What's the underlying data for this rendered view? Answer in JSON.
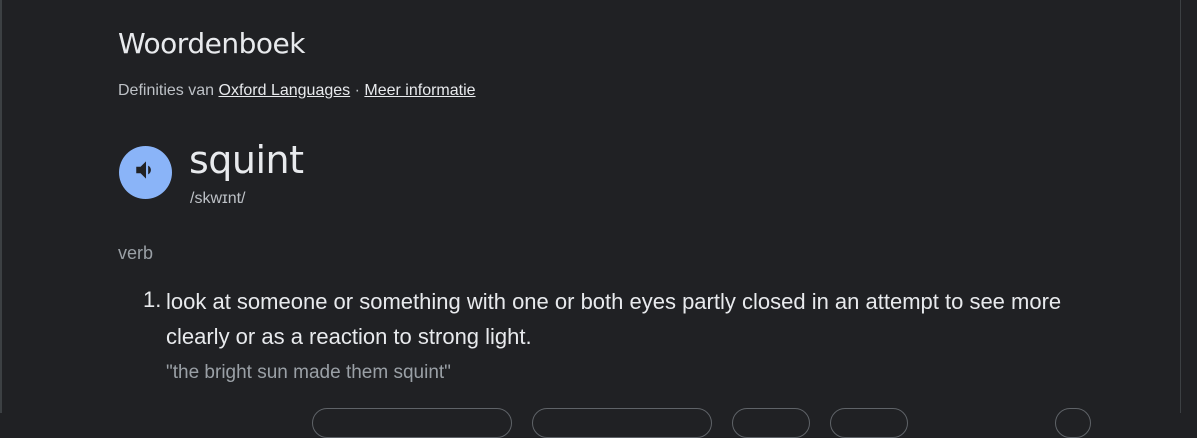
{
  "header": {
    "title": "Woordenboek",
    "source_prefix": "Definities van",
    "source_link": "Oxford Languages",
    "separator": "·",
    "more_info_link": "Meer informatie"
  },
  "entry": {
    "word": "squint",
    "phonetic": "/skwɪnt/",
    "speaker_icon": "volume-icon",
    "part_of_speech": "verb",
    "definitions": [
      {
        "number": "1.",
        "text": "look at someone or something with one or both eyes partly closed in an attempt to see more clearly or as a reaction to strong light.",
        "example": "\"the bright sun made them squint\""
      }
    ]
  },
  "colors": {
    "background": "#202124",
    "speaker_accent": "#8ab4f8",
    "text_primary": "#e8eaed",
    "text_secondary": "#9aa0a6"
  }
}
